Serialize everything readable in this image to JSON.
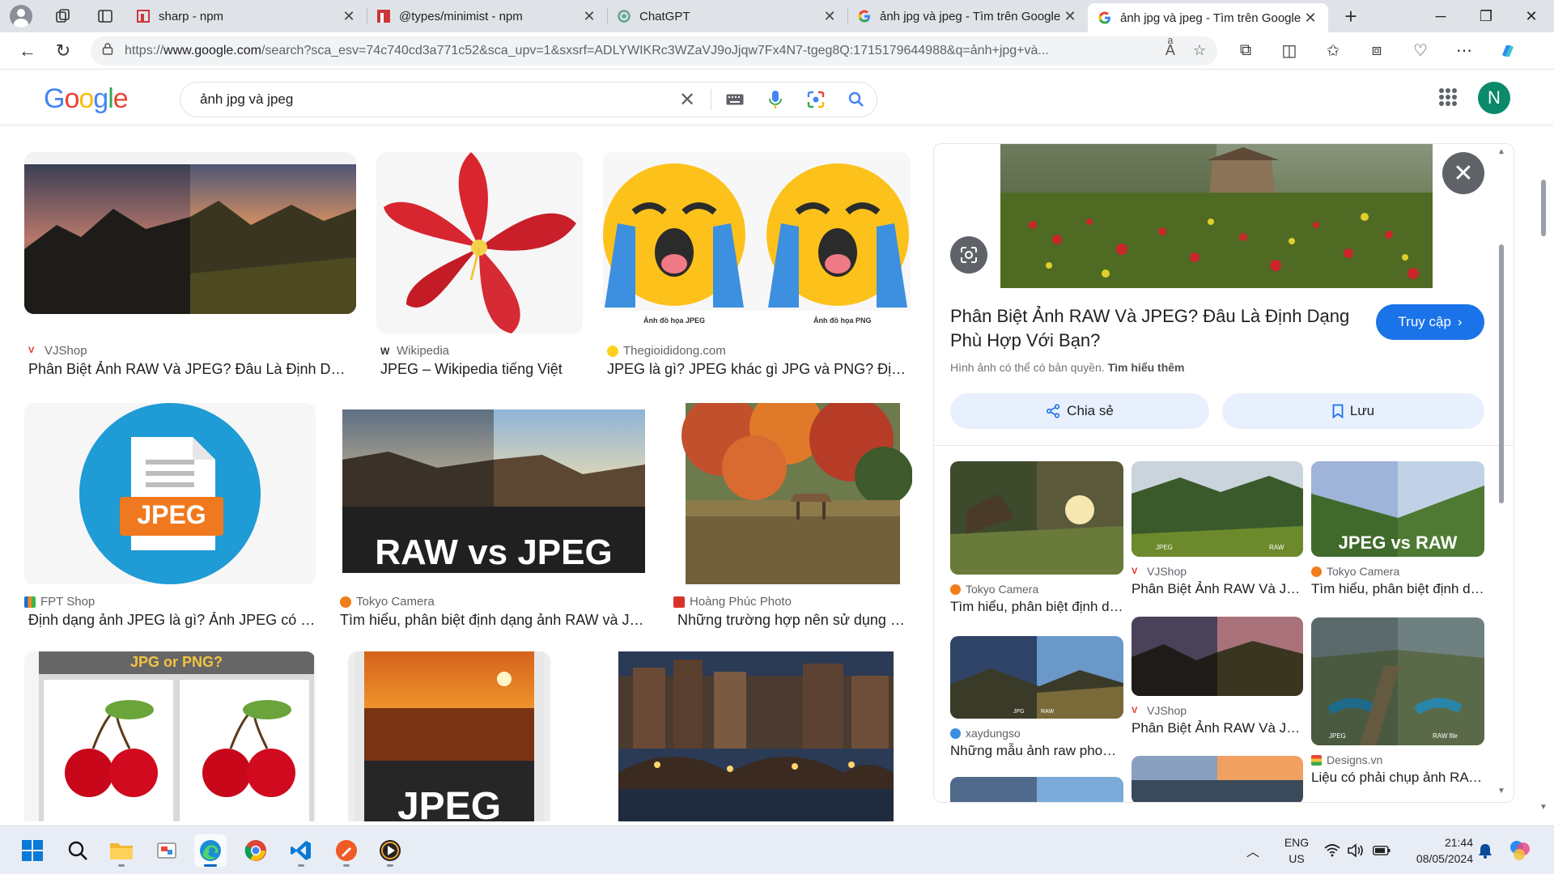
{
  "browser": {
    "tabs": [
      {
        "title": "sharp - npm",
        "active": false
      },
      {
        "title": "@types/minimist - npm",
        "active": false
      },
      {
        "title": "ChatGPT",
        "active": false
      },
      {
        "title": "ảnh jpg và jpeg - Tìm trên Google",
        "active": false
      },
      {
        "title": "ảnh jpg và jpeg - Tìm trên Google",
        "active": true
      }
    ],
    "url_prefix": "https://",
    "url_domain": "www.google.com",
    "url_rest": "/search?sca_esv=74c740cd3a771c52&sca_upv=1&sxsrf=ADLYWIKRc3WZaVJ9oJjqw7Fx4N7-tgeg8Q:1715179644988&q=ảnh+jpg+và..."
  },
  "google": {
    "logo": [
      "G",
      "o",
      "o",
      "g",
      "l",
      "e"
    ],
    "query": "ảnh jpg và jpeg",
    "account_initial": "N"
  },
  "results": [
    {
      "source": "VJShop",
      "title": "Phân Biệt Ảnh RAW Và JPEG? Đâu Là Định Dạng Phù Hợp Với Bạn?"
    },
    {
      "source": "Wikipedia",
      "title": "JPEG – Wikipedia tiếng Việt"
    },
    {
      "source": "Thegioididong.com",
      "title": "JPEG là gì? JPEG khác gì JPG và PNG? Định dạng ảnh nào tốt hơn?",
      "caption_left": "Ảnh đồ họa JPEG",
      "caption_right": "Ảnh đồ họa PNG"
    },
    {
      "source": "FPT Shop",
      "title": "Định dạng ảnh JPEG là gì? Ảnh JPEG có ưu nhược điểm gì?",
      "badge": "JPEG"
    },
    {
      "source": "Tokyo Camera",
      "title": "Tìm hiểu, phân biệt định dạng ảnh RAW và JPEG",
      "overlay": "RAW vs JPEG"
    },
    {
      "source": "Hoàng Phúc Photo",
      "title": "Những trường hợp nên sử dụng ảnh JPEG"
    },
    {
      "source": "",
      "title": "",
      "overlay": "JPG or PNG?"
    },
    {
      "source": "",
      "title": "",
      "overlay": "JPEG"
    },
    {
      "source": "",
      "title": ""
    }
  ],
  "panel": {
    "title": "Phân Biệt Ảnh RAW Và JPEG? Đâu Là Định Dạng Phù Hợp Với Bạn?",
    "visit_label": "Truy cập",
    "copyright_text": "Hình ảnh có thể có bản quyền.",
    "learn_more": "Tìm hiểu thêm",
    "share_label": "Chia sẻ",
    "save_label": "Lưu",
    "related": [
      {
        "source": "Tokyo Camera",
        "title": "Tìm hiểu, phân biệt định dạng..."
      },
      {
        "source": "VJShop",
        "title": "Phân Biệt Ảnh RAW Và JPEG?",
        "left_tag": "JPEG",
        "right_tag": "RAW"
      },
      {
        "source": "Tokyo Camera",
        "title": "Tìm hiểu, phân biệt định dạng...",
        "overlay": "JPEG vs RAW"
      },
      {
        "source": "xaydungso",
        "title": "Những mẫu ảnh raw phong cảnh",
        "left_tag": "JPG",
        "right_tag": "RAW"
      },
      {
        "source": "VJShop",
        "title": "Phân Biệt Ảnh RAW Và JPEG?"
      },
      {
        "source": "Designs.vn",
        "title": "Liệu có phải chụp ảnh RAW...",
        "left_tag": "JPEG",
        "right_tag": "RAW file"
      }
    ]
  },
  "taskbar": {
    "lang_line1": "ENG",
    "lang_line2": "US",
    "time": "21:44",
    "date": "08/05/2024"
  },
  "colors": {
    "accent": "#1a73e8",
    "avatar": "#0b8a6b",
    "taskbar": "#e8edf5"
  }
}
